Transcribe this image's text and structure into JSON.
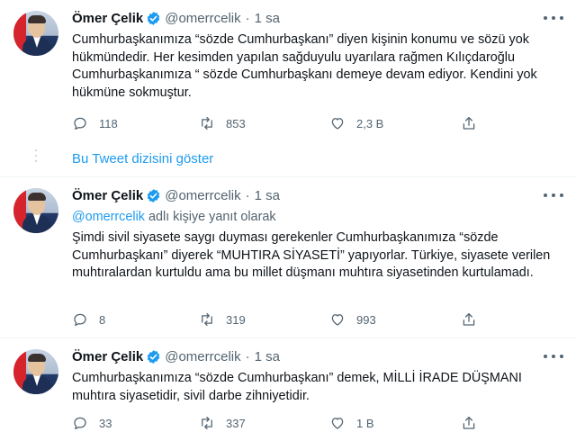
{
  "tweets": [
    {
      "author_name": "Ömer Çelik",
      "handle": "@omerrcelik",
      "time": "1 sa",
      "text": "Cumhurbaşkanımıza “sözde Cumhurbaşkanı” diyen kişinin konumu ve sözü yok hükmündedir. Her kesimden yapılan sağduyulu  uyarılara rağmen Kılıçdaroğlu Cumhurbaşkanımıza “ sözde Cumhurbaşkanı demeye devam ediyor. Kendini yok hükmüne sokmuştur.",
      "replies": "118",
      "retweets": "853",
      "likes": "2,3 B"
    },
    {
      "author_name": "Ömer Çelik",
      "handle": "@omerrcelik",
      "time": "1 sa",
      "reply_mention": "@omerrcelik",
      "reply_suffix": " adlı kişiye yanıt olarak",
      "text": "Şimdi sivil siyasete saygı duyması gerekenler Cumhurbaşkanımıza “sözde Cumhurbaşkanı” diyerek “MUHTIRA SİYASETİ” yapıyorlar. Türkiye, siyasete verilen muhtıralardan kurtuldu ama bu millet düşmanı muhtıra siyasetinden kurtulamadı.",
      "replies": "8",
      "retweets": "319",
      "likes": "993"
    },
    {
      "author_name": "Ömer Çelik",
      "handle": "@omerrcelik",
      "time": "1 sa",
      "text": "Cumhurbaşkanımıza “sözde Cumhurbaşkanı” demek, MİLLİ İRADE DÜŞMANI muhtıra siyasetidir, sivil darbe zihniyetidir.",
      "replies": "33",
      "retweets": "337",
      "likes": "1 B"
    }
  ],
  "show_thread_label": "Bu Tweet dizisini göster",
  "colors": {
    "accent": "#1d9bf0",
    "muted": "#536471",
    "text": "#0f1419",
    "divider": "#eff3f4"
  },
  "icons": [
    "verified-badge-icon",
    "more-icon",
    "reply-icon",
    "retweet-icon",
    "like-icon",
    "share-icon"
  ]
}
